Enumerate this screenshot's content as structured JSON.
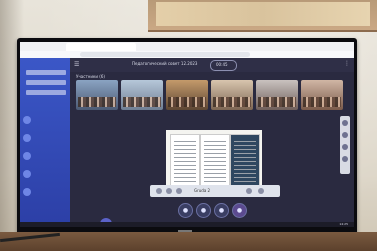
{
  "meeting": {
    "title": "Педагогический совет 12.2023",
    "timer": "00:45",
    "participants_label": "Участники (6)"
  },
  "controls": {
    "label": "Gruda 2",
    "buttons": [
      "camera",
      "mic",
      "screen",
      "chat",
      "leave"
    ]
  },
  "taskbar": {
    "clock": "14:25"
  },
  "colors": {
    "sidebar": "#3b57c7",
    "meeting_bg": "#2a2a40",
    "accent": "#5b62c8"
  }
}
